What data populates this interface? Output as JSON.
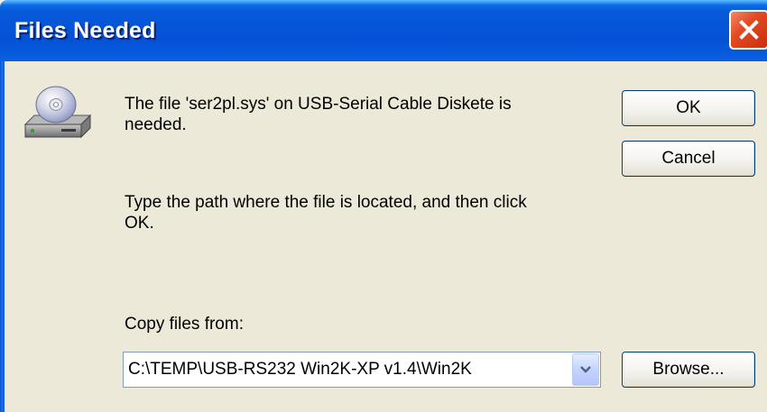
{
  "window": {
    "title": "Files Needed"
  },
  "message": {
    "line1": "The file 'ser2pl.sys' on USB-Serial Cable Diskete is",
    "line2": "needed.",
    "line3": "Type the path where the file is located, and then click",
    "line4": "OK."
  },
  "copy_from": {
    "label": "Copy files from:",
    "value": "C:\\TEMP\\USB-RS232 Win2K-XP v1.4\\Win2K"
  },
  "buttons": {
    "ok": "OK",
    "cancel": "Cancel",
    "browse": "Browse..."
  },
  "icons": {
    "title_close": "close-icon",
    "drive": "cd-drive-icon",
    "dropdown": "chevron-down-icon"
  },
  "colors": {
    "titlebar": "#0654d8",
    "close": "#e24a24",
    "dialog_bg": "#ece9d8",
    "button_border": "#003c74"
  }
}
